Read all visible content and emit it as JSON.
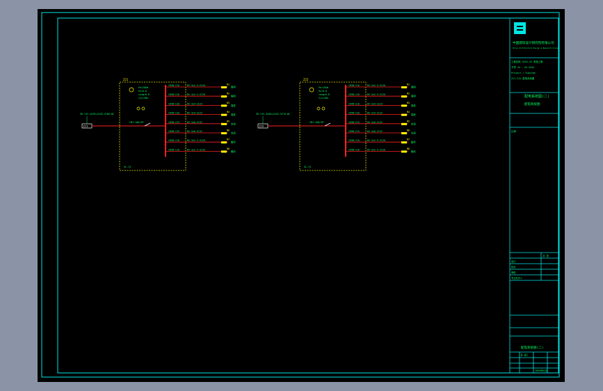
{
  "colors": {
    "background": "#000000",
    "frame": "#00e5e5",
    "panel_outline": "#e6e600",
    "busbar": "#ff2020",
    "label": "#ffff00",
    "text": "#00ff66",
    "viewport_border": "#8a94a6"
  },
  "title_block": {
    "logo_icon": "company-logo",
    "company_name": "中国建筑设计研究院有限公司",
    "company_sub": "China Architecture Design & Research Group",
    "info_lines": [
      "工程名称 XXXX-XX 改造工程",
      "子项 XX — XX-XXXX",
      "Project / Subitem",
      "ZJ1-ZJ2 配电系统图"
    ],
    "drawing_title": "配电系统图(二)",
    "drawing_sub": "配电系统图",
    "fields": [
      "设计",
      "校对",
      "审核",
      "专业负责人"
    ],
    "sheet_label": "共 张",
    "scale_label": "比例",
    "bottom_title": "配电系统图(二)",
    "drawing_no": "D-02",
    "date": "2009年6月"
  },
  "panels": [
    {
      "name": "ZJ1",
      "source_label": "ZJ1",
      "incoming_cable": "ZR-YJV-4X70+1X35-SC80-WC",
      "incoming_breaker": "CM1-100/3P",
      "params": [
        "Pe=20kW",
        "Kx=0.8",
        "cosφ=0.8",
        "Ijs=38A"
      ],
      "bottom_note": "XL-21",
      "circuits": [
        {
          "breaker": "C65N-C16",
          "cable": "BV-3x2.5-SC20",
          "code": "N1",
          "load": "照明"
        },
        {
          "breaker": "C65N-C16",
          "cable": "BV-3x2.5-SC20",
          "code": "N2",
          "load": "照明"
        },
        {
          "breaker": "C65N-C20",
          "cable": "BV-3x4-SC25",
          "code": "N3",
          "load": "插座"
        },
        {
          "breaker": "C65N-C20",
          "cable": "BV-3x4-SC25",
          "code": "N4",
          "load": "插座"
        },
        {
          "breaker": "C65N-C25",
          "cable": "BV-5x6-SC32",
          "code": "N5",
          "load": "空调"
        },
        {
          "breaker": "C65N-C25",
          "cable": "BV-5x6-SC32",
          "code": "N6",
          "load": "空调"
        },
        {
          "breaker": "C65N-C16",
          "cable": "BV-3x2.5-SC20",
          "code": "N7",
          "load": "备用"
        },
        {
          "breaker": "C65N-C16",
          "cable": "BV-3x2.5-SC20",
          "code": "N8",
          "load": "备用"
        }
      ]
    },
    {
      "name": "ZJ2",
      "source_label": "ZJ2",
      "incoming_cable": "ZR-YJV-4X50+1X25-SC70-WC",
      "incoming_breaker": "CM1-100/3P",
      "params": [
        "Pe=15kW",
        "Kx=0.8",
        "cosφ=0.8",
        "Ijs=28A"
      ],
      "bottom_note": "XL-21",
      "circuits": [
        {
          "breaker": "C65N-C16",
          "cable": "BV-3x2.5-SC20",
          "code": "N1",
          "load": "照明"
        },
        {
          "breaker": "C65N-C16",
          "cable": "BV-3x2.5-SC20",
          "code": "N2",
          "load": "照明"
        },
        {
          "breaker": "C65N-C20",
          "cable": "BV-3x4-SC25",
          "code": "N3",
          "load": "插座"
        },
        {
          "breaker": "C65N-C20",
          "cable": "BV-3x4-SC25",
          "code": "N4",
          "load": "插座"
        },
        {
          "breaker": "C65N-C25",
          "cable": "BV-5x6-SC32",
          "code": "N5",
          "load": "空调"
        },
        {
          "breaker": "C65N-C25",
          "cable": "BV-5x6-SC32",
          "code": "N6",
          "load": "空调"
        },
        {
          "breaker": "C65N-C16",
          "cable": "BV-3x2.5-SC20",
          "code": "N7",
          "load": "备用"
        },
        {
          "breaker": "C65N-C16",
          "cable": "BV-3x2.5-SC20",
          "code": "N8",
          "load": "备用"
        }
      ]
    }
  ]
}
